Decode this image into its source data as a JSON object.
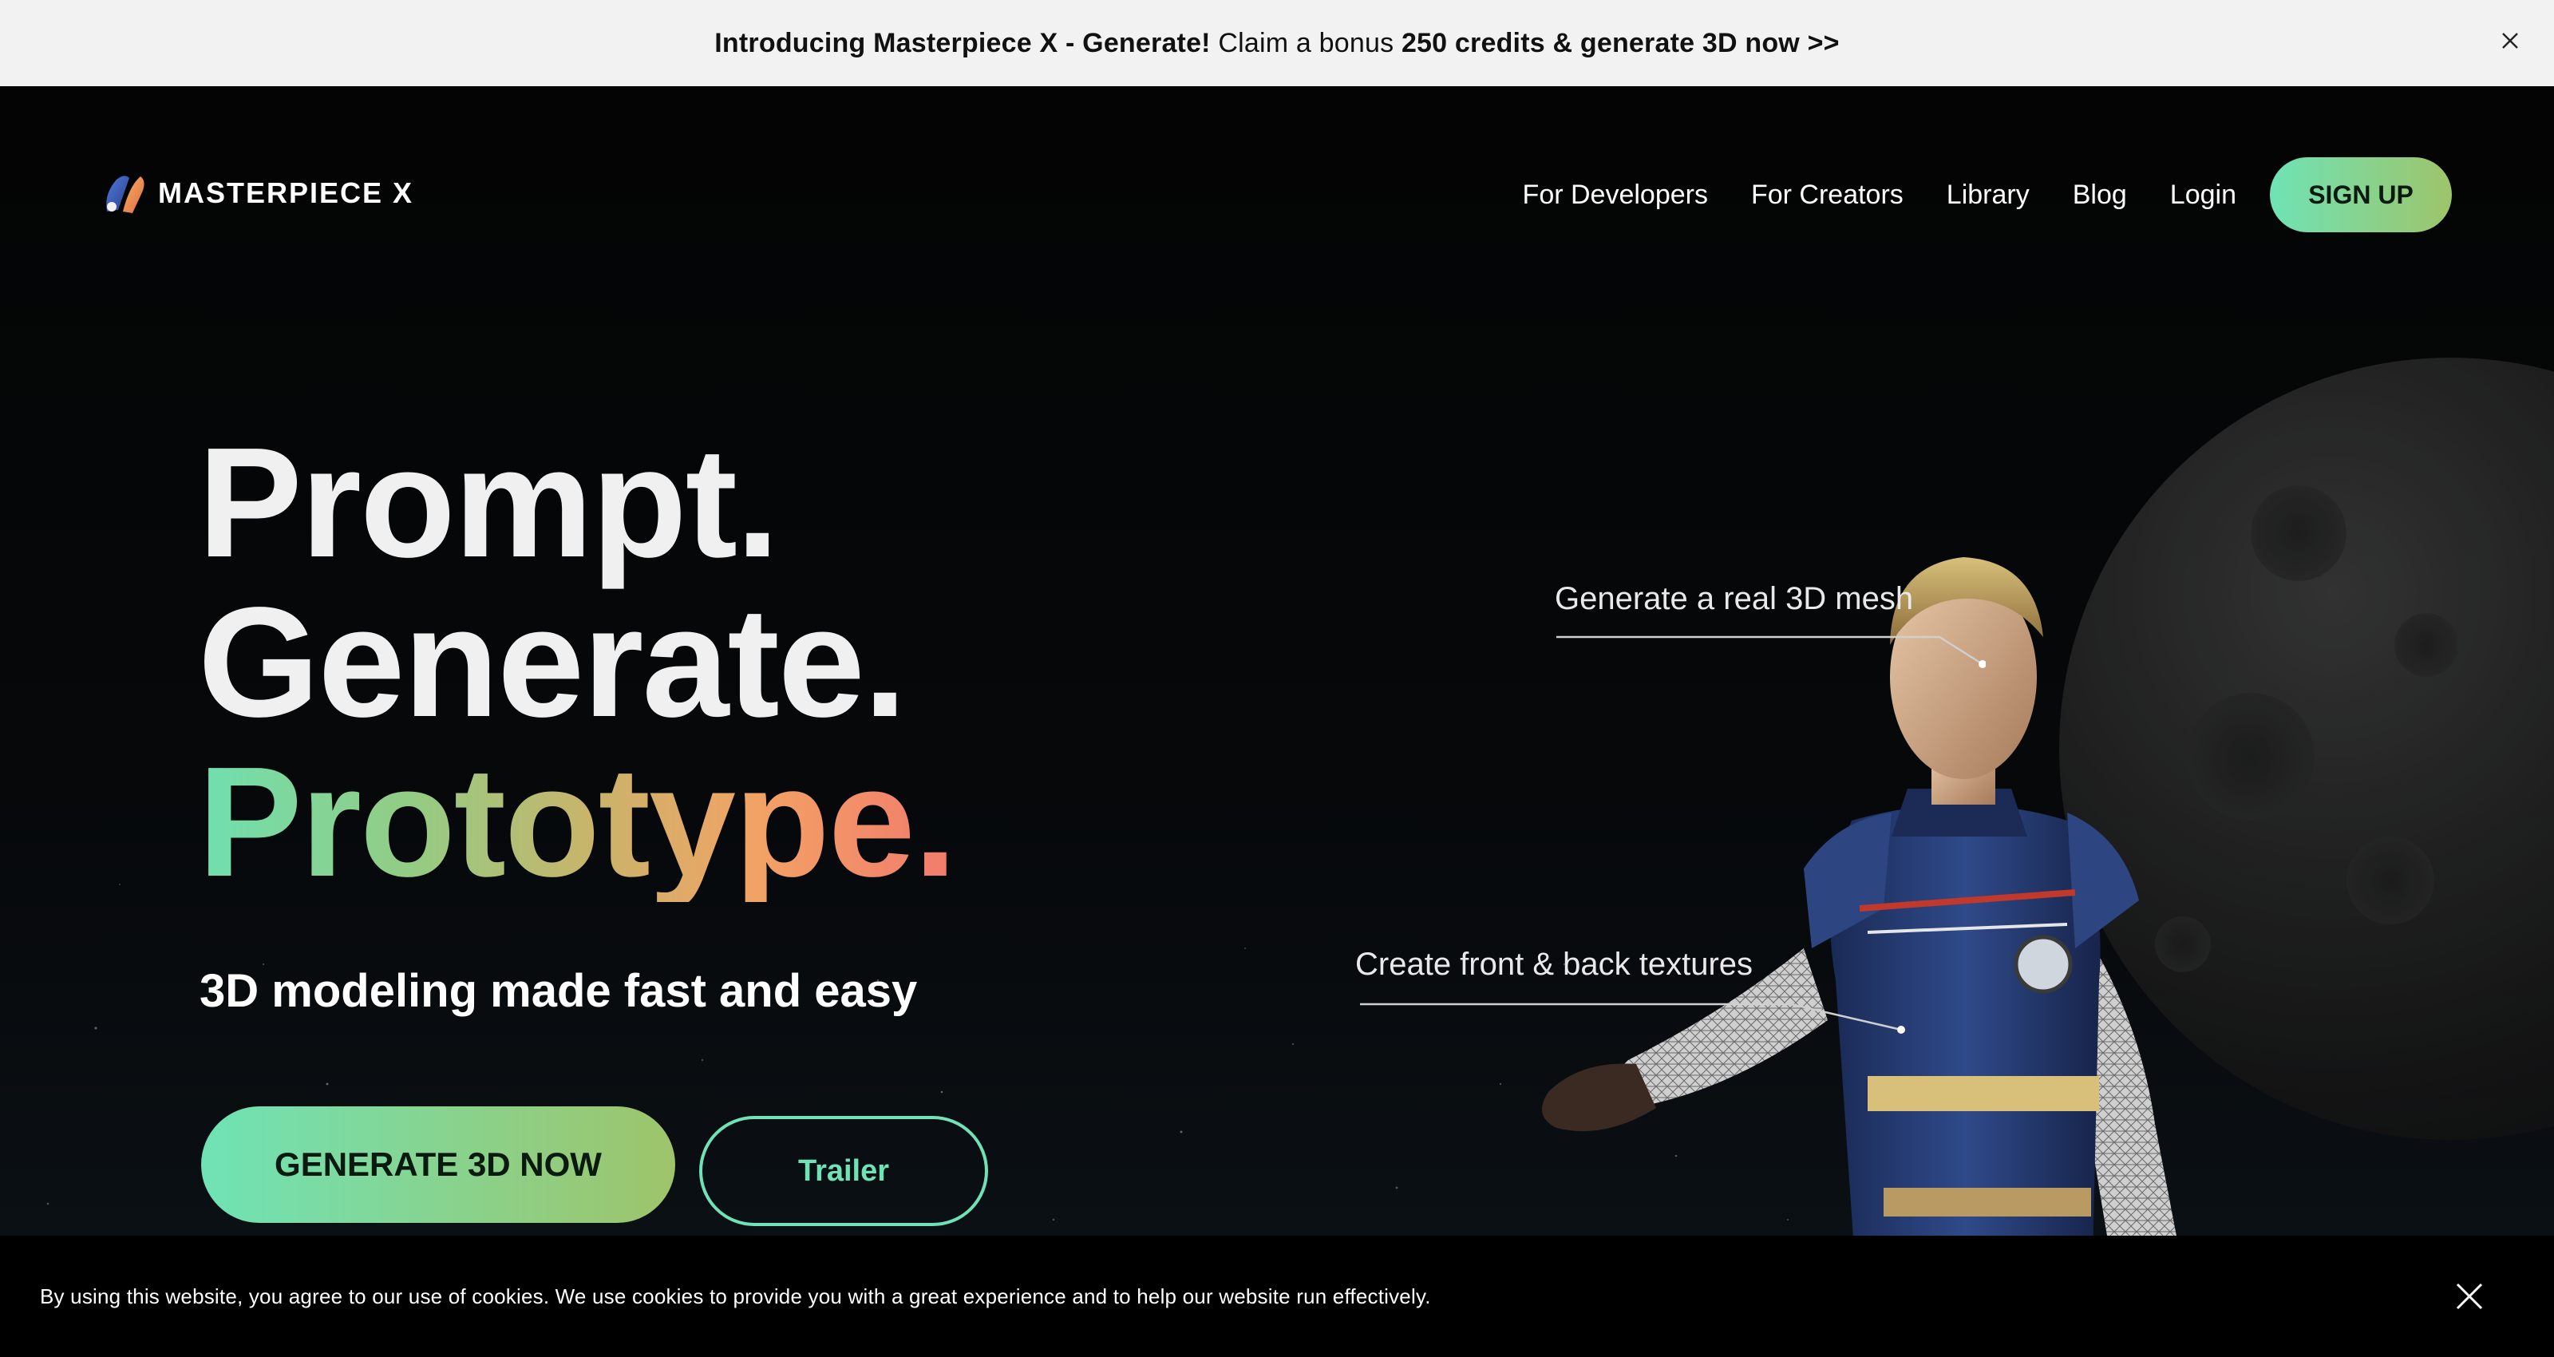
{
  "announcement": {
    "part1": "Introducing Masterpiece X - Generate!",
    "part2": " Claim a bonus ",
    "part3": "250 credits & generate 3D now >>"
  },
  "brand": {
    "logo_text": "MASTERPIECE X"
  },
  "nav": {
    "items": [
      {
        "label": "For Developers"
      },
      {
        "label": "For Creators"
      },
      {
        "label": "Library"
      },
      {
        "label": "Blog"
      },
      {
        "label": "Login"
      }
    ],
    "signup_label": "SIGN UP"
  },
  "hero": {
    "line1": "Prompt.",
    "line2": "Generate.",
    "line3": "Prototype.",
    "subtitle": "3D modeling made fast and easy",
    "cta_label": "GENERATE 3D NOW",
    "trailer_label": "Trailer"
  },
  "callouts": {
    "mesh": "Generate a real 3D mesh",
    "textures": "Create front & back textures"
  },
  "cookie": {
    "text": "By using this website, you agree to our use of cookies. We use cookies to provide you with a great experience and to help our website run effectively."
  },
  "colors": {
    "accent_start": "#6fe3b6",
    "accent_end": "#9ec46a",
    "background": "#050505",
    "announcement_bg": "#f2f2f2"
  }
}
